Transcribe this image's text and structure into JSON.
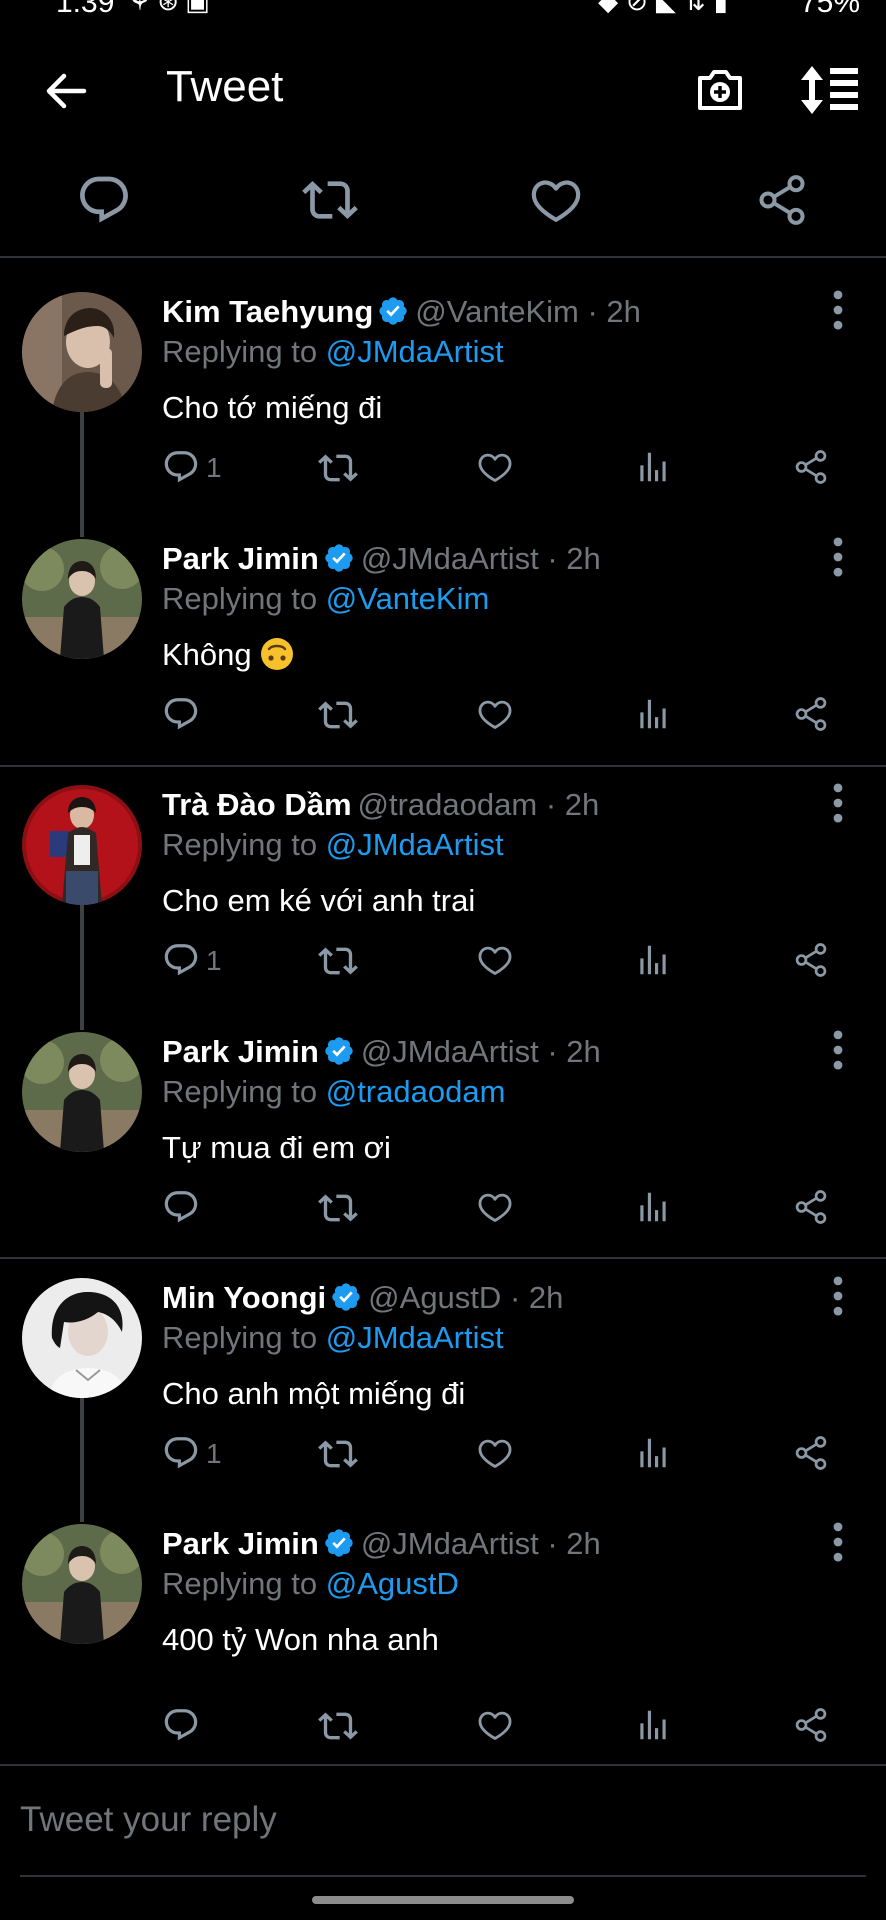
{
  "status_bar": {
    "time": "1:39",
    "battery": "75%"
  },
  "header": {
    "title": "Tweet"
  },
  "reply_box": {
    "placeholder": "Tweet your reply"
  },
  "colors": {
    "accent": "#1d9bf0",
    "muted": "#71767b",
    "divider": "#2f3336"
  },
  "tweets": [
    {
      "name": "Kim Taehyung",
      "verified": true,
      "handle": "@VanteKim",
      "time": "· 2h",
      "replying_label": "Replying to",
      "replying_to": "@JMdaArtist",
      "text": "Cho tớ miếng đi",
      "reply_count": "1",
      "avatar_icon": "avatar-kim-taehyung"
    },
    {
      "name": "Park Jimin",
      "verified": true,
      "handle": "@JMdaArtist",
      "time": "· 2h",
      "replying_label": "Replying to",
      "replying_to": "@VanteKim",
      "text": "Không",
      "emoji": "upside-down-face",
      "reply_count": "",
      "avatar_icon": "avatar-park-jimin"
    },
    {
      "name": "Trà Đào Dầm",
      "verified": false,
      "handle": "@tradaodam",
      "time": "· 2h",
      "replying_label": "Replying to",
      "replying_to": "@JMdaArtist",
      "text": "Cho em ké với anh trai",
      "reply_count": "1",
      "avatar_icon": "avatar-tra-dao-dam"
    },
    {
      "name": "Park Jimin",
      "verified": true,
      "handle": "@JMdaArtist",
      "time": "· 2h",
      "replying_label": "Replying to",
      "replying_to": "@tradaodam",
      "text": "Tự mua đi em ơi",
      "reply_count": "",
      "avatar_icon": "avatar-park-jimin"
    },
    {
      "name": "Min Yoongi",
      "verified": true,
      "handle": "@AgustD",
      "time": "· 2h",
      "replying_label": "Replying to",
      "replying_to": "@JMdaArtist",
      "text": "Cho anh một miếng đi",
      "reply_count": "1",
      "avatar_icon": "avatar-min-yoongi"
    },
    {
      "name": "Park Jimin",
      "verified": true,
      "handle": "@JMdaArtist",
      "time": "· 2h",
      "replying_label": "Replying to",
      "replying_to": "@AgustD",
      "text": "400 tỷ Won nha anh",
      "reply_count": "",
      "avatar_icon": "avatar-park-jimin"
    }
  ]
}
